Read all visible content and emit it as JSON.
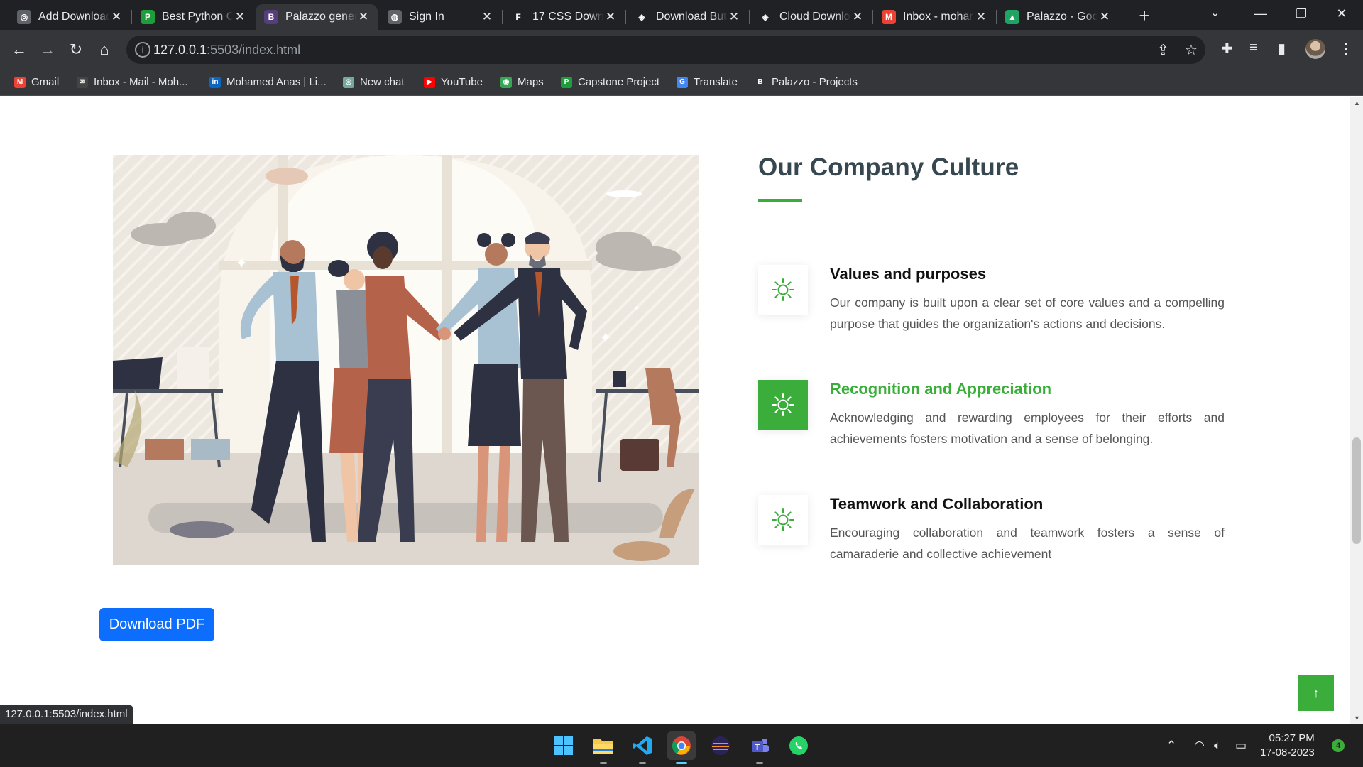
{
  "browser": {
    "tabs": [
      {
        "title": "Add Download",
        "favicon": "chatgpt-icon",
        "color": "#5f6368",
        "glyph": "◎"
      },
      {
        "title": "Best Python O",
        "favicon": "python-site-icon",
        "color": "#1e9e3a",
        "glyph": "P"
      },
      {
        "title": "Palazzo gener",
        "favicon": "bootstrap-icon",
        "color": "#563d7c",
        "glyph": "B"
      },
      {
        "title": "Sign In",
        "favicon": "globe-icon",
        "color": "#5f6368",
        "glyph": "◍"
      },
      {
        "title": "17 CSS Downl",
        "favicon": "freefrontend-icon",
        "color": "#202124",
        "glyph": "F"
      },
      {
        "title": "Download But",
        "favicon": "codepen-icon",
        "color": "#202124",
        "glyph": "◈"
      },
      {
        "title": "Cloud Downlo",
        "favicon": "codepen-icon",
        "color": "#202124",
        "glyph": "◈"
      },
      {
        "title": "Inbox - mohar",
        "favicon": "gmail-icon",
        "color": "#ea4335",
        "glyph": "M"
      },
      {
        "title": "Palazzo - Goo",
        "favicon": "google-drive-icon",
        "color": "#1fa463",
        "glyph": "▲"
      }
    ],
    "url_host": "127.0.0.1",
    "url_rest": ":5503/index.html",
    "bookmarks": [
      {
        "label": "Gmail",
        "icon": "gmail-icon",
        "color": "#ea4335",
        "glyph": "M"
      },
      {
        "label": "Inbox - Mail - Moh...",
        "icon": "mail-envelope-icon",
        "color": "#444",
        "glyph": "✉"
      },
      {
        "label": "Mohamed Anas | Li...",
        "icon": "linkedin-icon",
        "color": "#0a66c2",
        "glyph": "in"
      },
      {
        "label": "New chat",
        "icon": "chatgpt-icon",
        "color": "#74aa9c",
        "glyph": "◎"
      },
      {
        "label": "YouTube",
        "icon": "youtube-icon",
        "color": "#ff0000",
        "glyph": "▶"
      },
      {
        "label": "Maps",
        "icon": "google-maps-icon",
        "color": "#34a853",
        "glyph": "◉"
      },
      {
        "label": "Capstone Project",
        "icon": "python-site-icon",
        "color": "#1e9e3a",
        "glyph": "P"
      },
      {
        "label": "Translate",
        "icon": "google-translate-icon",
        "color": "#4285f4",
        "glyph": "G"
      },
      {
        "label": "Palazzo - Projects",
        "icon": "bootstrap-icon",
        "color": "#35363a",
        "glyph": "B"
      }
    ],
    "status_url": "127.0.0.1:5503/index.html"
  },
  "page": {
    "culture_title": "Our Company Culture",
    "items": [
      {
        "title": "Values and purposes",
        "desc": "Our company is built upon a clear set of core values and a compelling purpose that guides the organization's actions and decisions.",
        "active": false
      },
      {
        "title": "Recognition and Appreciation",
        "desc": "Acknowledging and rewarding employees for their efforts and achievements fosters motivation and a sense of belonging.",
        "active": true
      },
      {
        "title": "Teamwork and Collaboration",
        "desc": "Encouraging collaboration and teamwork fosters a sense of camaraderie and collective achievement",
        "active": false
      }
    ],
    "download_label": "Download PDF",
    "accent_color": "#3aad3a",
    "button_color": "#0d6efd"
  },
  "taskbar": {
    "apps": [
      "windows-start-icon",
      "file-explorer-icon",
      "vscode-icon",
      "chrome-icon",
      "eclipse-icon",
      "teams-icon",
      "whatsapp-icon"
    ],
    "time": "05:27 PM",
    "date": "17-08-2023",
    "notifications": "4"
  }
}
